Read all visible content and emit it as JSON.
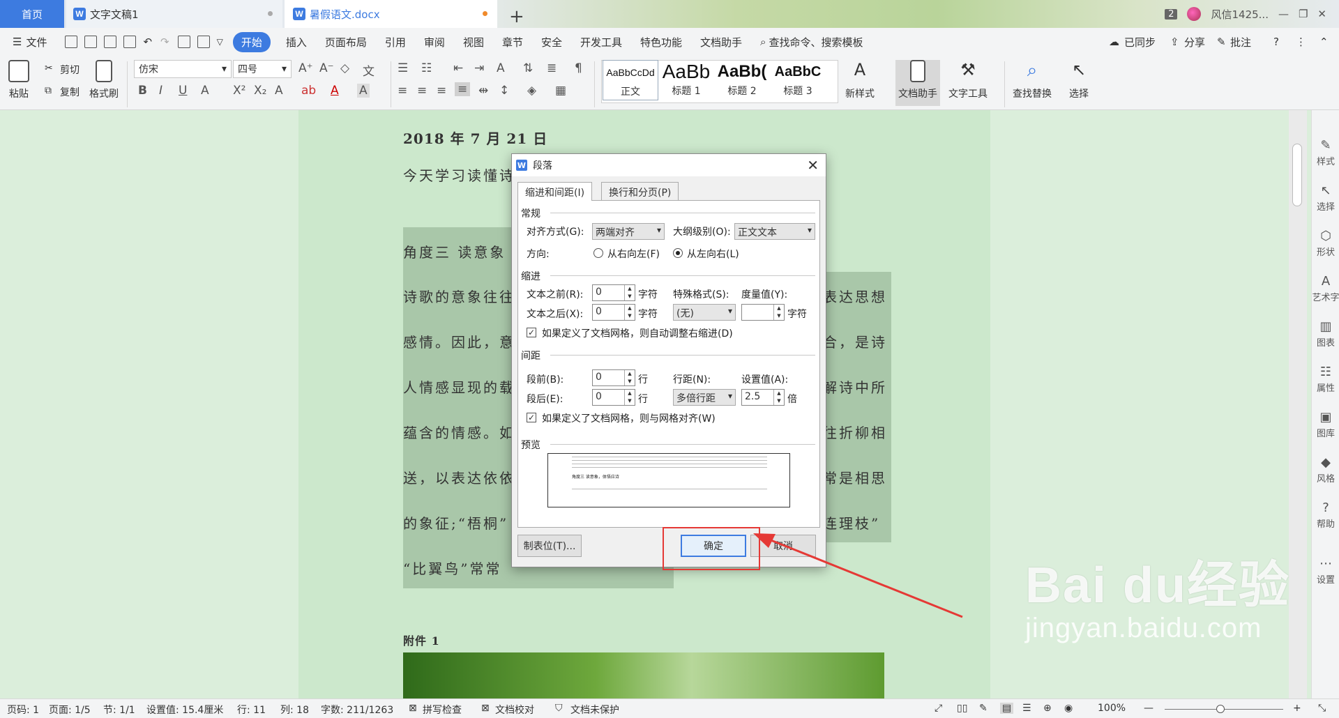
{
  "tabs": {
    "home": "首页",
    "doc1": "文字文稿1",
    "doc2": "暑假语文.docx",
    "add": "+"
  },
  "titlebar": {
    "count": "2",
    "user": "风信1425..."
  },
  "menu": {
    "file": "文件",
    "items": [
      "开始",
      "插入",
      "页面布局",
      "引用",
      "审阅",
      "视图",
      "章节",
      "安全",
      "开发工具",
      "特色功能",
      "文档助手"
    ],
    "search": "查找命令、搜索模板",
    "synced": "已同步",
    "share": "分享",
    "comment": "批注"
  },
  "ribbon": {
    "paste": "粘贴",
    "cut": "剪切",
    "copy": "复制",
    "format_painter": "格式刷",
    "font_name": "仿宋",
    "font_size": "四号",
    "styles": [
      {
        "preview": "AaBbCcDd",
        "label": "正文"
      },
      {
        "preview": "AaBb",
        "label": "标题 1"
      },
      {
        "preview": "AaBb(",
        "label": "标题 2"
      },
      {
        "preview": "AaBbC",
        "label": "标题 3"
      }
    ],
    "new_style": "新样式",
    "doc_helper": "文档助手",
    "text_tools": "文字工具",
    "find_replace": "查找替换",
    "select": "选择"
  },
  "document": {
    "date": "2018 年 7 月 21 日",
    "lines": [
      "今天学习读懂诗",
      "角度三   读意象",
      "诗歌的意象往往",
      "感情。因此，意",
      "人情感显现的载",
      "蕴含的情感。如",
      "送，以表达依依",
      "的象征;“梧桐”",
      "“比翼鸟”常常"
    ],
    "right_lines": [
      "表达思想",
      "合，是诗",
      "解诗中所",
      "往折柳相",
      "常是相思",
      "连理枝”"
    ],
    "attachment": "附件 1"
  },
  "dialog": {
    "title": "段落",
    "tab1": "缩进和间距(I)",
    "tab2": "换行和分页(P)",
    "general": "常规",
    "align_label": "对齐方式(G):",
    "align_value": "两端对齐",
    "outline_label": "大纲级别(O):",
    "outline_value": "正文文本",
    "direction_label": "方向:",
    "rtl": "从右向左(F)",
    "ltr": "从左向右(L)",
    "indent": "缩进",
    "before_text_label": "文本之前(R):",
    "before_text_value": "0",
    "after_text_label": "文本之后(X):",
    "after_text_value": "0",
    "unit_char": "字符",
    "special_label": "特殊格式(S):",
    "special_value": "(无)",
    "measure_label": "度量值(Y):",
    "measure_value": "",
    "auto_indent": "如果定义了文档网格，则自动调整右缩进(D)",
    "spacing": "间距",
    "before_label": "段前(B):",
    "before_value": "0",
    "after_label": "段后(E):",
    "after_value": "0",
    "unit_line": "行",
    "line_spacing_label": "行距(N):",
    "line_spacing_value": "多倍行距",
    "set_value_label": "设置值(A):",
    "set_value": "2.5",
    "unit_times": "倍",
    "snap_grid": "如果定义了文档网格，则与网格对齐(W)",
    "preview": "预览",
    "preview_mid": "角度三   读意象，体悟应诗",
    "tabs_button": "制表位(T)...",
    "ok": "确定",
    "cancel": "取消"
  },
  "sidebar": [
    "样式",
    "选择",
    "形状",
    "艺术字",
    "图表",
    "属性",
    "图库",
    "风格",
    "帮助",
    "设置"
  ],
  "status": {
    "page_code": "页码: 1",
    "page": "页面: 1/5",
    "section": "节: 1/1",
    "set_value": "设置值: 15.4厘米",
    "row": "行: 11",
    "col": "列: 18",
    "words": "字数: 211/1263",
    "spell": "拼写检查",
    "proof": "文档校对",
    "protect": "文档未保护",
    "zoom": "100%"
  },
  "watermark": {
    "brand": "Bai du经验",
    "url": "jingyan.baidu.com"
  },
  "colors": {
    "accent": "#3d7be0",
    "highlight_red": "#e53935",
    "page_bg": "#cce8cc"
  }
}
